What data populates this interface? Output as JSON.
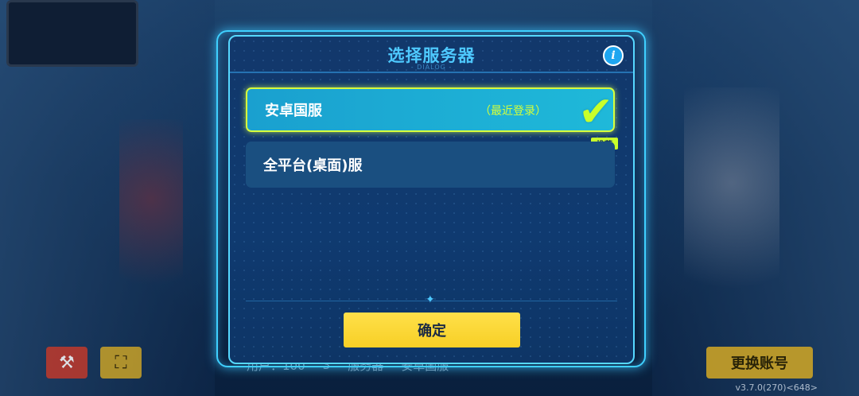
{
  "dialog": {
    "title": "选择服务器",
    "subtitle": "- DIALOG -",
    "info_icon": "i",
    "confirm_label": "确定"
  },
  "servers": [
    {
      "name": "安卓国服",
      "tag": "（最近登录）",
      "selected": true,
      "badge": "推荐"
    },
    {
      "name": "全平台(桌面)服",
      "tag": "",
      "selected": false
    }
  ],
  "background": {
    "switch_account_label": "更换账号",
    "bottom_bar_items": [
      "用户：100",
      "3",
      "服务器",
      "安卓国服"
    ],
    "version": "v3.7.0(270)<648>"
  },
  "icons": {
    "tools": "tools-icon",
    "scan": "scan-icon",
    "check": "checkmark-icon",
    "info": "info-icon"
  },
  "colors": {
    "accent": "#4ec9ff",
    "selected_border": "#d8ff3c",
    "confirm": "#f7cf25"
  }
}
